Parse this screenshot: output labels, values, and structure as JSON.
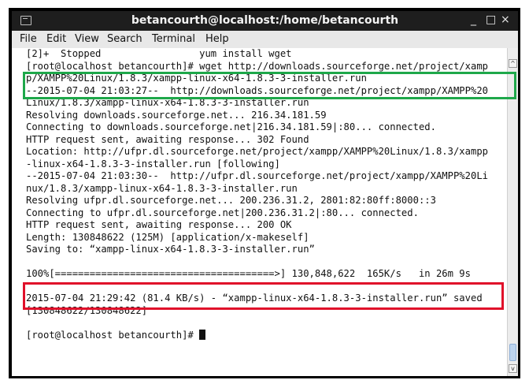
{
  "window": {
    "title": "betancourth@localhost:/home/betancourth",
    "minimize": "_",
    "maximize": "□",
    "close": "×"
  },
  "menu": [
    "File",
    "Edit",
    "View",
    "Search",
    "Terminal",
    "Help"
  ],
  "terminal": {
    "lines": [
      "[2]+  Stopped                 yum install wget",
      "[root@localhost betancourth]# wget http://downloads.sourceforge.net/project/xamp",
      "p/XAMPP%20Linux/1.8.3/xampp-linux-x64-1.8.3-3-installer.run",
      "--2015-07-04 21:03:27--  http://downloads.sourceforge.net/project/xampp/XAMPP%20",
      "Linux/1.8.3/xampp-linux-x64-1.8.3-3-installer.run",
      "Resolving downloads.sourceforge.net... 216.34.181.59",
      "Connecting to downloads.sourceforge.net|216.34.181.59|:80... connected.",
      "HTTP request sent, awaiting response... 302 Found",
      "Location: http://ufpr.dl.sourceforge.net/project/xampp/XAMPP%20Linux/1.8.3/xampp",
      "-linux-x64-1.8.3-3-installer.run [following]",
      "--2015-07-04 21:03:30--  http://ufpr.dl.sourceforge.net/project/xampp/XAMPP%20Li",
      "nux/1.8.3/xampp-linux-x64-1.8.3-3-installer.run",
      "Resolving ufpr.dl.sourceforge.net... 200.236.31.2, 2801:82:80ff:8000::3",
      "Connecting to ufpr.dl.sourceforge.net|200.236.31.2|:80... connected.",
      "HTTP request sent, awaiting response... 200 OK",
      "Length: 130848622 (125M) [application/x-makeself]",
      "Saving to: “xampp-linux-x64-1.8.3-3-installer.run”",
      "",
      "100%[======================================>] 130,848,622  165K/s   in 26m 9s",
      "",
      "2015-07-04 21:29:42 (81.4 KB/s) - “xampp-linux-x64-1.8.3-3-installer.run” saved",
      "[130848622/130848622]",
      "",
      "[root@localhost betancourth]# "
    ]
  },
  "scroll_up": "^",
  "scroll_down": "v",
  "scroll_grip": "≡"
}
